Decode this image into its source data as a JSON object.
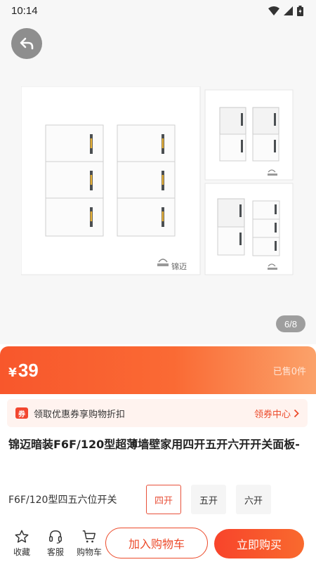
{
  "status_bar": {
    "time": "10:14"
  },
  "gallery": {
    "page_indicator": "6/8",
    "brand_mark": "锦迈"
  },
  "price_bar": {
    "currency": "¥",
    "price": "39",
    "sold": "已售0件"
  },
  "coupon": {
    "icon_text": "券",
    "text": "领取优惠券享购物折扣",
    "link": "领券中心"
  },
  "product": {
    "title": "锦迈暗装F6F/120型超薄墙壁家用四开五开六开开关面板-"
  },
  "spec": {
    "label": "F6F/120型四五六位开关",
    "options": [
      "四开",
      "五开",
      "六开"
    ],
    "selected": "四开"
  },
  "bottom_bar": {
    "favorite": "收藏",
    "service": "客服",
    "cart": "购物车",
    "add_to_cart": "加入购物车",
    "buy_now": "立即购买"
  },
  "colors": {
    "accent": "#f8572c",
    "price_gradient_end": "#fba26a",
    "coupon_bg": "#fff3ef"
  }
}
